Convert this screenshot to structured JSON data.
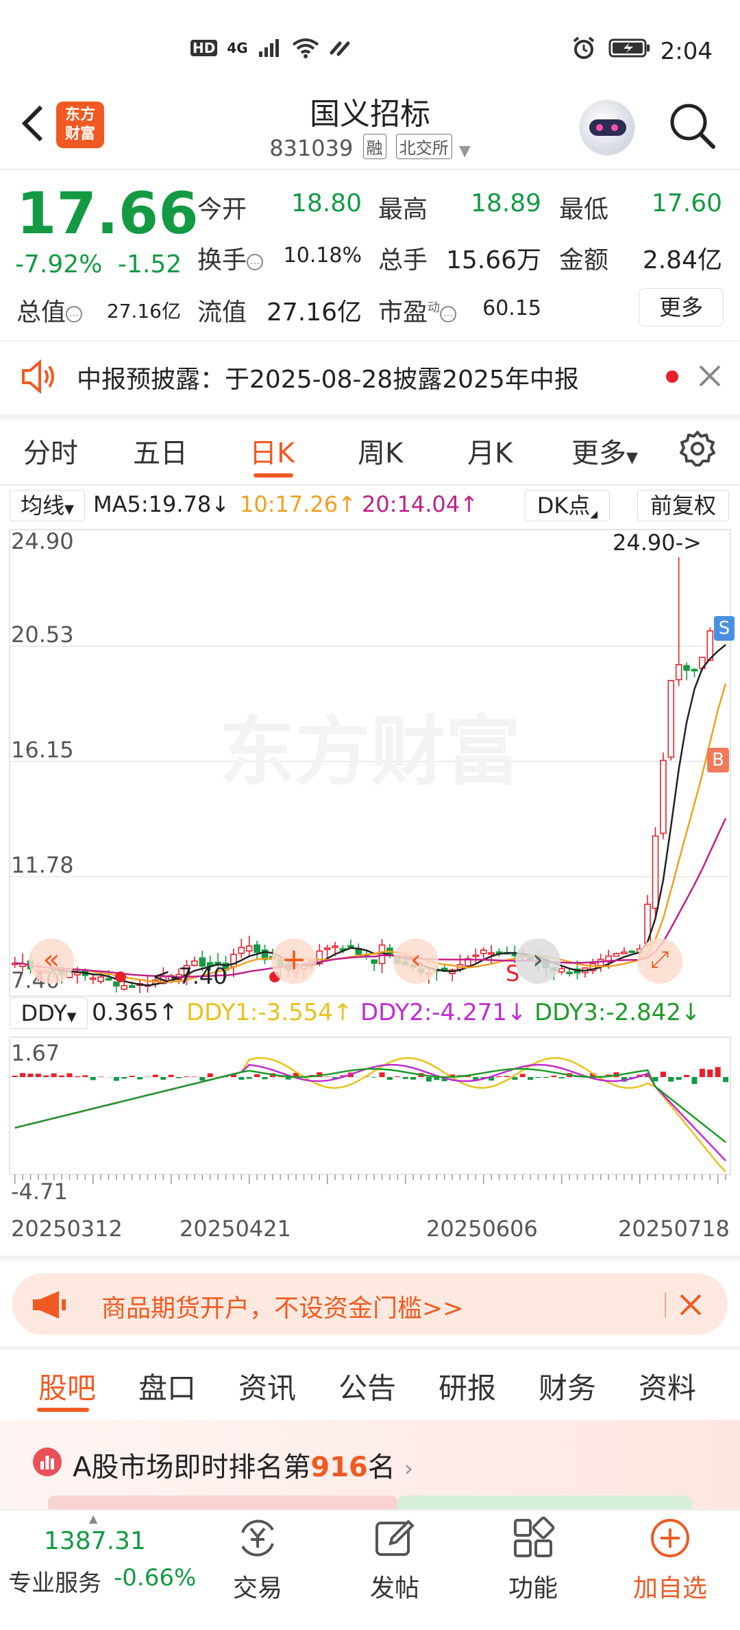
{
  "status_bar": {
    "time": "2:04",
    "net_label": "HD",
    "net_gen": "4G"
  },
  "header": {
    "logo_text_line1": "东方",
    "logo_text_line2": "财富",
    "title": "国义招标",
    "code": "831039",
    "tag_margin": "融",
    "tag_exchange": "北交所"
  },
  "quote": {
    "price": "17.66",
    "change_pct": "-7.92%",
    "change_abs": "-1.52",
    "open_label": "今开",
    "open_value": "18.80",
    "high_label": "最高",
    "high_value": "18.89",
    "low_label": "最低",
    "low_value": "17.60",
    "turnover_label": "换手",
    "turnover_value": "10.18%",
    "volume_label": "总手",
    "volume_value": "15.66万",
    "amount_label": "金额",
    "amount_value": "2.84亿",
    "mktcap_label": "总值",
    "mktcap_value": "27.16亿",
    "float_label": "流值",
    "float_value": "27.16亿",
    "pe_label": "市盈",
    "pe_super": "动",
    "pe_value": "60.15",
    "more_label": "更多",
    "up_color": "#e8202a",
    "down_color": "#139a43"
  },
  "notice": {
    "text": "中报预披露：于2025-08-28披露2025年中报"
  },
  "periods": {
    "items": [
      "分时",
      "五日",
      "日K",
      "周K",
      "月K",
      "更多"
    ],
    "active": "日K"
  },
  "ma_bar": {
    "select_label": "均线",
    "ma5": "MA5:19.78",
    "ma10": "10:17.26",
    "ma20": "20:14.04",
    "dk_label": "DK点",
    "adjust_label": "前复权",
    "ma5_color": "#222222",
    "ma10_color": "#f0a020",
    "ma20_color": "#c0208a"
  },
  "kline": {
    "y_labels": [
      "24.90",
      "20.53",
      "16.15",
      "11.78",
      "7.40"
    ],
    "max_label": "24.90->",
    "min_label": "<-7.40",
    "buy_marker": "B",
    "sell_marker": "S",
    "watermark": "东方财富",
    "s_marker_lower": "S"
  },
  "ddy": {
    "select_label": "DDY",
    "ddy": "0.365",
    "ddy1": "DDY1:-3.554",
    "ddy2": "DDY2:-4.271",
    "ddy3": "DDY3:-2.842",
    "y_top": "1.67",
    "y_bottom": "-4.71",
    "ddy1_color": "#e8c21a",
    "ddy2_color": "#c02bd0",
    "ddy3_color": "#1f9a2a"
  },
  "x_dates": [
    "20250312",
    "20250421",
    "20250606",
    "20250718"
  ],
  "banner": {
    "text": "商品期货开户，不设资金门槛>>"
  },
  "bottom_tabs": {
    "items": [
      "股吧",
      "盘口",
      "资讯",
      "公告",
      "研报",
      "财务",
      "资料"
    ],
    "active": "股吧"
  },
  "rank": {
    "prefix": "A股市场即时排名第",
    "number": "916",
    "suffix": "名"
  },
  "bottom_nav": {
    "index_value": "1387.31",
    "index_label": "专业服务",
    "index_change": "-0.66%",
    "trade": "交易",
    "post": "发帖",
    "functions": "功能",
    "add_watch": "加自选"
  }
}
